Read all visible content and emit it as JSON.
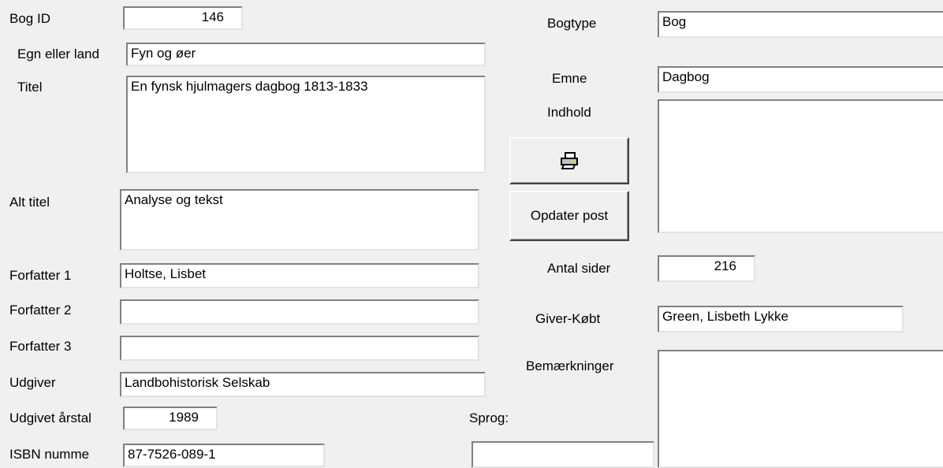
{
  "form": {
    "bog_id": {
      "label": "Bog ID",
      "value": "146"
    },
    "egn": {
      "label": "Egn eller land",
      "value": "Fyn og øer"
    },
    "titel": {
      "label": "Titel",
      "value": "En fynsk hjulmagers dagbog 1813-1833"
    },
    "alt_titel": {
      "label": "Alt titel",
      "value": "Analyse og tekst"
    },
    "forfatter1": {
      "label": "Forfatter 1",
      "value": "Holtse, Lisbet"
    },
    "forfatter2": {
      "label": "Forfatter 2",
      "value": ""
    },
    "forfatter3": {
      "label": "Forfatter 3",
      "value": ""
    },
    "udgiver": {
      "label": "Udgiver",
      "value": "Landbohistorisk Selskab"
    },
    "udgivet_aarstal": {
      "label": "Udgivet årstal",
      "value": "1989"
    },
    "isbn": {
      "label": "ISBN numme",
      "value": "87-7526-089-1"
    },
    "sprog": {
      "label": "Sprog:",
      "value": ""
    },
    "bogtype": {
      "label": "Bogtype",
      "value": "Bog"
    },
    "emne": {
      "label": "Emne",
      "value": "Dagbog"
    },
    "indhold": {
      "label": "Indhold",
      "value": ""
    },
    "antal_sider": {
      "label": "Antal sider",
      "value": "216"
    },
    "giver_koebt": {
      "label": "Giver-Købt",
      "value": "Green, Lisbeth Lykke"
    },
    "bemaerkninger": {
      "label": "Bemærkninger",
      "value": ""
    }
  },
  "buttons": {
    "print_icon": "printer-icon",
    "update_label": "Opdater post"
  }
}
